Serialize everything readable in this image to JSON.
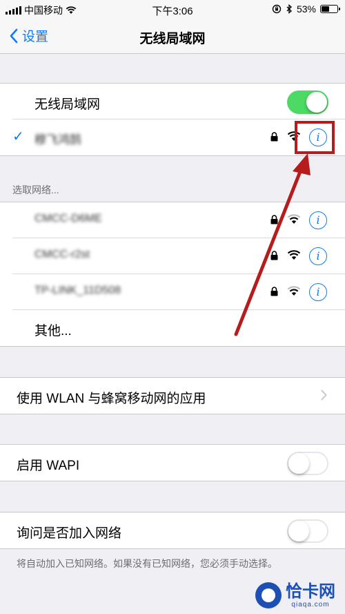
{
  "status_bar": {
    "carrier": "中国移动",
    "time": "下午3:06",
    "battery_percent": "53%",
    "battery_level": 0.53
  },
  "nav": {
    "back_label": "设置",
    "title": "无线局域网"
  },
  "wifi_toggle": {
    "label": "无线局域网",
    "on": true
  },
  "connected_network": {
    "name": "穆飞鸿鹄",
    "secured": true
  },
  "choose_network_header": "选取网络...",
  "networks": [
    {
      "name": "CMCC-D6ME",
      "secured": true
    },
    {
      "name": "CMCC-r2st",
      "secured": true
    },
    {
      "name": "TP-LINK_11D508",
      "secured": true
    }
  ],
  "other_label": "其他...",
  "wlan_apps_label": "使用 WLAN 与蜂窝移动网的应用",
  "wapi": {
    "label": "启用 WAPI",
    "on": false
  },
  "ask_join": {
    "label": "询问是否加入网络",
    "on": false,
    "note": "将自动加入已知网络。如果没有已知网络，您必须手动选择。"
  },
  "watermark": {
    "name": "恰卡网",
    "url": "qiaqa.com"
  },
  "colors": {
    "accent": "#0a7aff",
    "toggle_on": "#4cd964",
    "annotation": "#b71c1c",
    "watermark": "#1e4fb3"
  }
}
